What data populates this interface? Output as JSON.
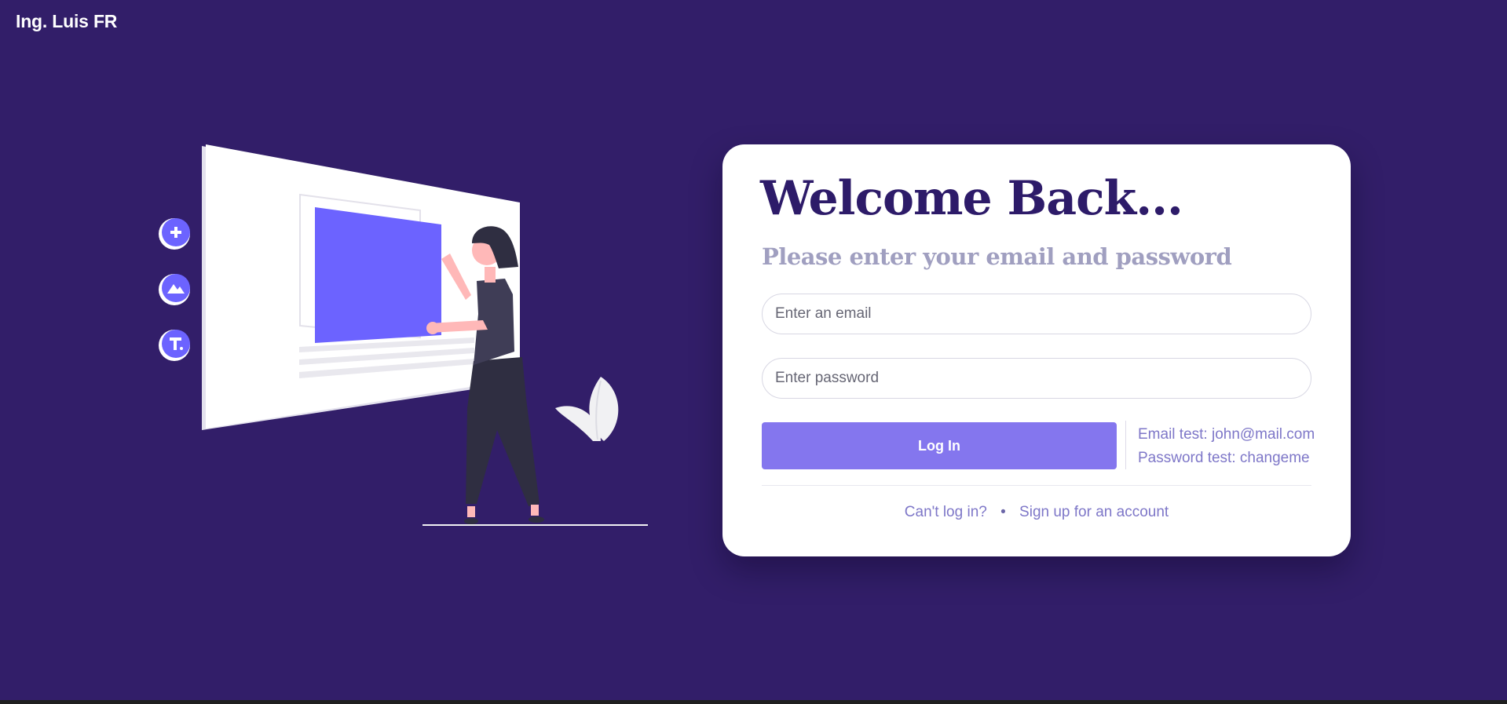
{
  "header": {
    "brand": "Ing. Luis FR"
  },
  "illustration": {
    "icons": [
      "plus-icon",
      "mountain-image-icon",
      "text-tool-icon"
    ],
    "accent_color": "#6c63ff"
  },
  "login_card": {
    "title": "Welcome Back...",
    "subtitle": "Please enter your email and password",
    "email_placeholder": "Enter an email",
    "password_placeholder": "Enter password",
    "login_button": "Log In",
    "email_test": "Email test: john@mail.com",
    "password_test": "Password test: changeme",
    "cant_login": "Can't log in?",
    "separator": "•",
    "signup": "Sign up for an account"
  },
  "colors": {
    "background": "#321e69",
    "title": "#2d1b69",
    "subtitle": "#a09fc0",
    "button": "#8476ee",
    "link": "#7e77c8"
  }
}
